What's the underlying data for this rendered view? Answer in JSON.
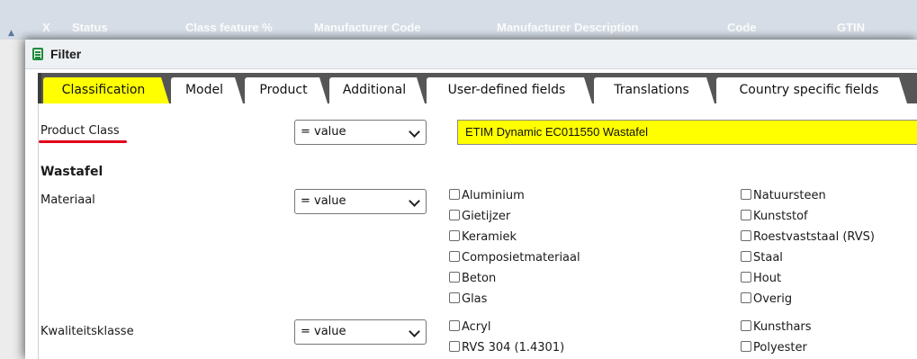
{
  "background_grid": {
    "columns": [
      "X",
      "Status",
      "Class feature %",
      "Manufacturer Code",
      "Manufacturer Description",
      "Code",
      "GTIN"
    ]
  },
  "dialog": {
    "title": "Filter",
    "icon": "filter-form-icon"
  },
  "tabs": [
    {
      "label": "Classification",
      "active": true
    },
    {
      "label": "Model",
      "active": false
    },
    {
      "label": "Product",
      "active": false
    },
    {
      "label": "Additional",
      "active": false
    },
    {
      "label": "User-defined fields",
      "active": false
    },
    {
      "label": "Translations",
      "active": false
    },
    {
      "label": "Country specific fields",
      "active": false
    }
  ],
  "product_class": {
    "label": "Product Class",
    "operator": "= value",
    "value": "ETIM Dynamic EC011550 Wastafel"
  },
  "section_title": "Wastafel",
  "features": [
    {
      "label": "Materiaal",
      "operator": "= value",
      "options_col1": [
        "Aluminium",
        "Gietijzer",
        "Keramiek",
        "Composietmateriaal",
        "Beton",
        "Glas"
      ],
      "options_col2": [
        "Natuursteen",
        "Kunststof",
        "Roestvaststaal (RVS)",
        "Staal",
        "Hout",
        "Overig"
      ]
    },
    {
      "label": "Kwaliteitsklasse",
      "operator": "= value",
      "options_col1": [
        "Acryl",
        "RVS 304 (1.4301)"
      ],
      "options_col2": [
        "Kunsthars",
        "Polyester"
      ]
    }
  ],
  "colors": {
    "highlight": "#ffff00",
    "tab_bar": "#565656",
    "underline_accent": "#e2001a",
    "filter_icon": "#1e8a3b"
  }
}
